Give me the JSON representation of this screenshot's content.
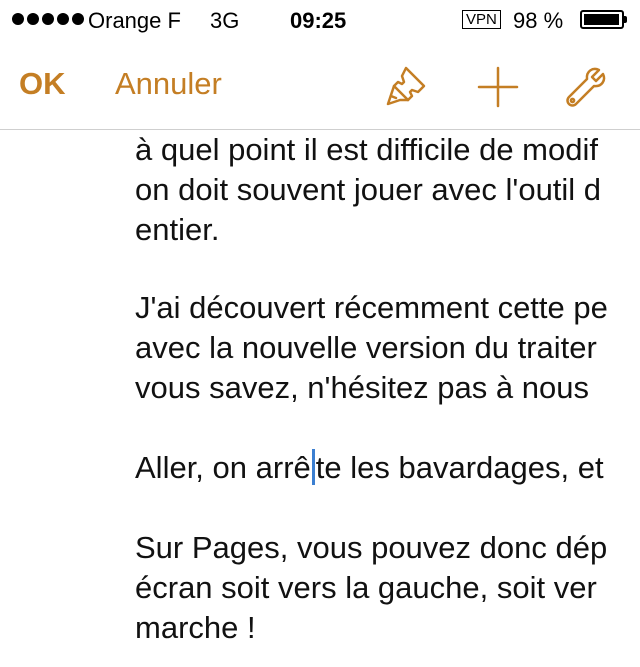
{
  "status_bar": {
    "carrier": "Orange F",
    "network": "3G",
    "time": "09:25",
    "vpn": "VPN",
    "battery": "98 %",
    "battery_level": 0.98
  },
  "toolbar": {
    "ok_label": "OK",
    "cancel_label": "Annuler",
    "brush_icon": "paintbrush-icon",
    "plus_icon": "plus-icon",
    "wrench_icon": "wrench-icon",
    "accent_color": "#c47e24"
  },
  "document": {
    "lines": [
      "à quel point il est difficile de modif",
      "on doit souvent jouer avec l'outil d",
      "entier.",
      "J'ai découvert récemment cette pe",
      "avec la nouvelle version du traiter",
      "vous savez, n'hésitez pas à nous",
      "Sur Pages, vous pouvez donc dép",
      "écran soit vers la gauche, soit ver",
      "marche !"
    ],
    "caret_line": {
      "before": "Aller, on arrê",
      "after": "te les bavardages, et"
    },
    "caret_color": "#3b7fd1"
  }
}
